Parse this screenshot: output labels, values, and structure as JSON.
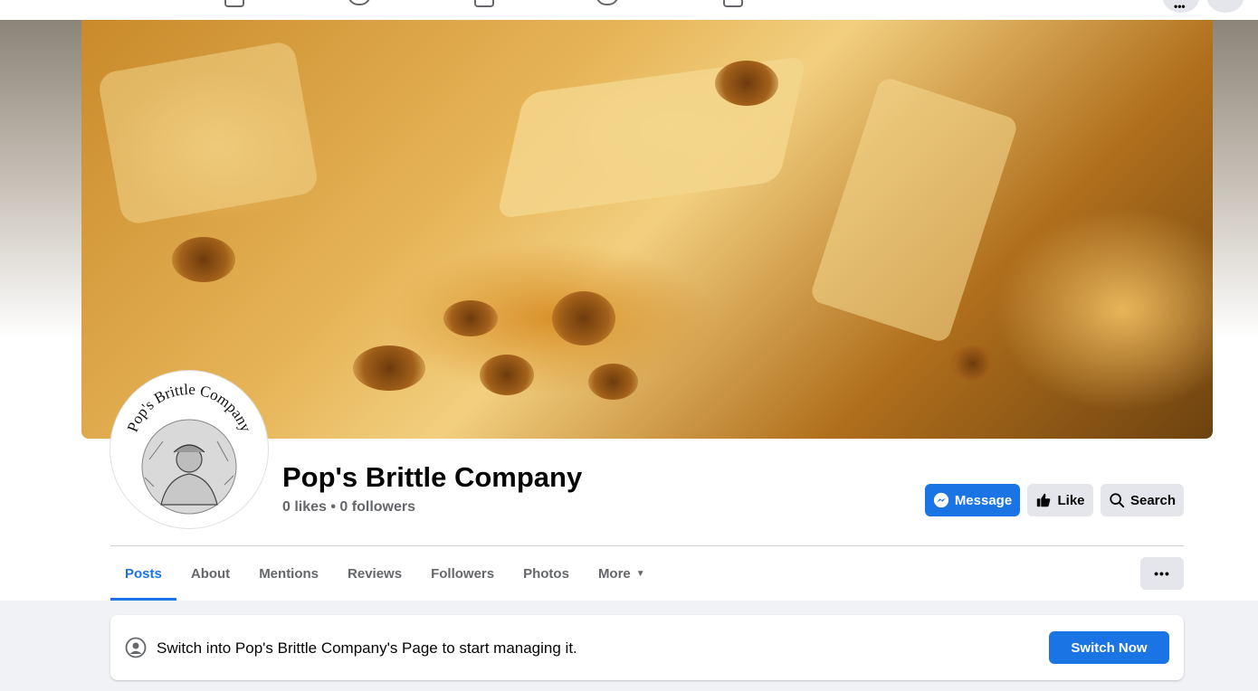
{
  "page": {
    "name": "Pop's Brittle Company",
    "stats": "0 likes • 0 followers",
    "avatar_text": "Pop's Brittle Company"
  },
  "actions": {
    "message_label": "Message",
    "like_label": "Like",
    "search_label": "Search"
  },
  "tabs": [
    {
      "label": "Posts",
      "active": true
    },
    {
      "label": "About"
    },
    {
      "label": "Mentions"
    },
    {
      "label": "Reviews"
    },
    {
      "label": "Followers"
    },
    {
      "label": "Photos"
    },
    {
      "label": "More"
    }
  ],
  "more_menu_label": "•••",
  "switch_banner": {
    "text": "Switch into Pop's Brittle Company's Page to start managing it.",
    "button_label": "Switch Now"
  },
  "colors": {
    "accent": "#1b74e4",
    "secondary_button": "#e4e6eb",
    "muted_text": "#65676b",
    "background": "#f0f2f5"
  },
  "icons": {
    "message": "messenger-icon",
    "like": "thumbs-up-icon",
    "search": "search-icon",
    "switch": "profile-switch-icon",
    "more": "ellipsis-icon"
  }
}
